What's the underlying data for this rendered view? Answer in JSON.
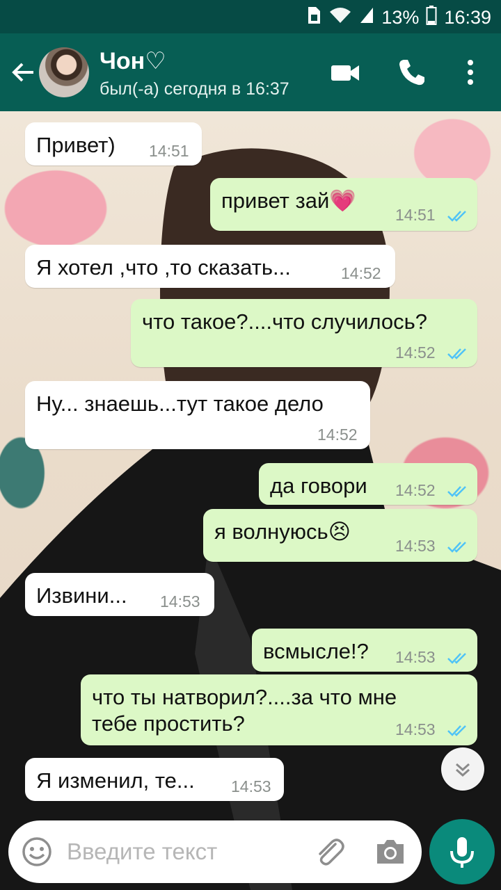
{
  "status_bar": {
    "battery": "13%",
    "time": "16:39"
  },
  "header": {
    "name": "Чон♡",
    "status": "был(-а) сегодня в 16:37"
  },
  "messages": [
    {
      "dir": "in",
      "text": "Привет)",
      "time": "14:51"
    },
    {
      "dir": "out",
      "text": "привет зай💗",
      "time": "14:51"
    },
    {
      "dir": "in",
      "text": "Я хотел ,что ,то сказать...",
      "time": "14:52"
    },
    {
      "dir": "out",
      "text": "что такое?....что случилось?",
      "time": "14:52"
    },
    {
      "dir": "in",
      "text": "Ну... знаешь...тут такое дело",
      "time": "14:52"
    },
    {
      "dir": "out",
      "text": "да говори",
      "time": "14:52"
    },
    {
      "dir": "out",
      "text": "я волнуюсь😣",
      "time": "14:53"
    },
    {
      "dir": "in",
      "text": "Извини...",
      "time": "14:53"
    },
    {
      "dir": "out",
      "text": "всмысле!?",
      "time": "14:53"
    },
    {
      "dir": "out",
      "text": "что ты натворил?....за что мне",
      "text2": "тебе простить?",
      "time": "14:53"
    },
    {
      "dir": "in",
      "text": "Я изменил, те...",
      "time": "14:53"
    }
  ],
  "input": {
    "placeholder": "Введите текст"
  },
  "colors": {
    "header": "#075e54",
    "outgoing": "#dcf8c6",
    "incoming": "#ffffff",
    "mic": "#0a8a7b",
    "read_ticks": "#4fc3f7"
  }
}
